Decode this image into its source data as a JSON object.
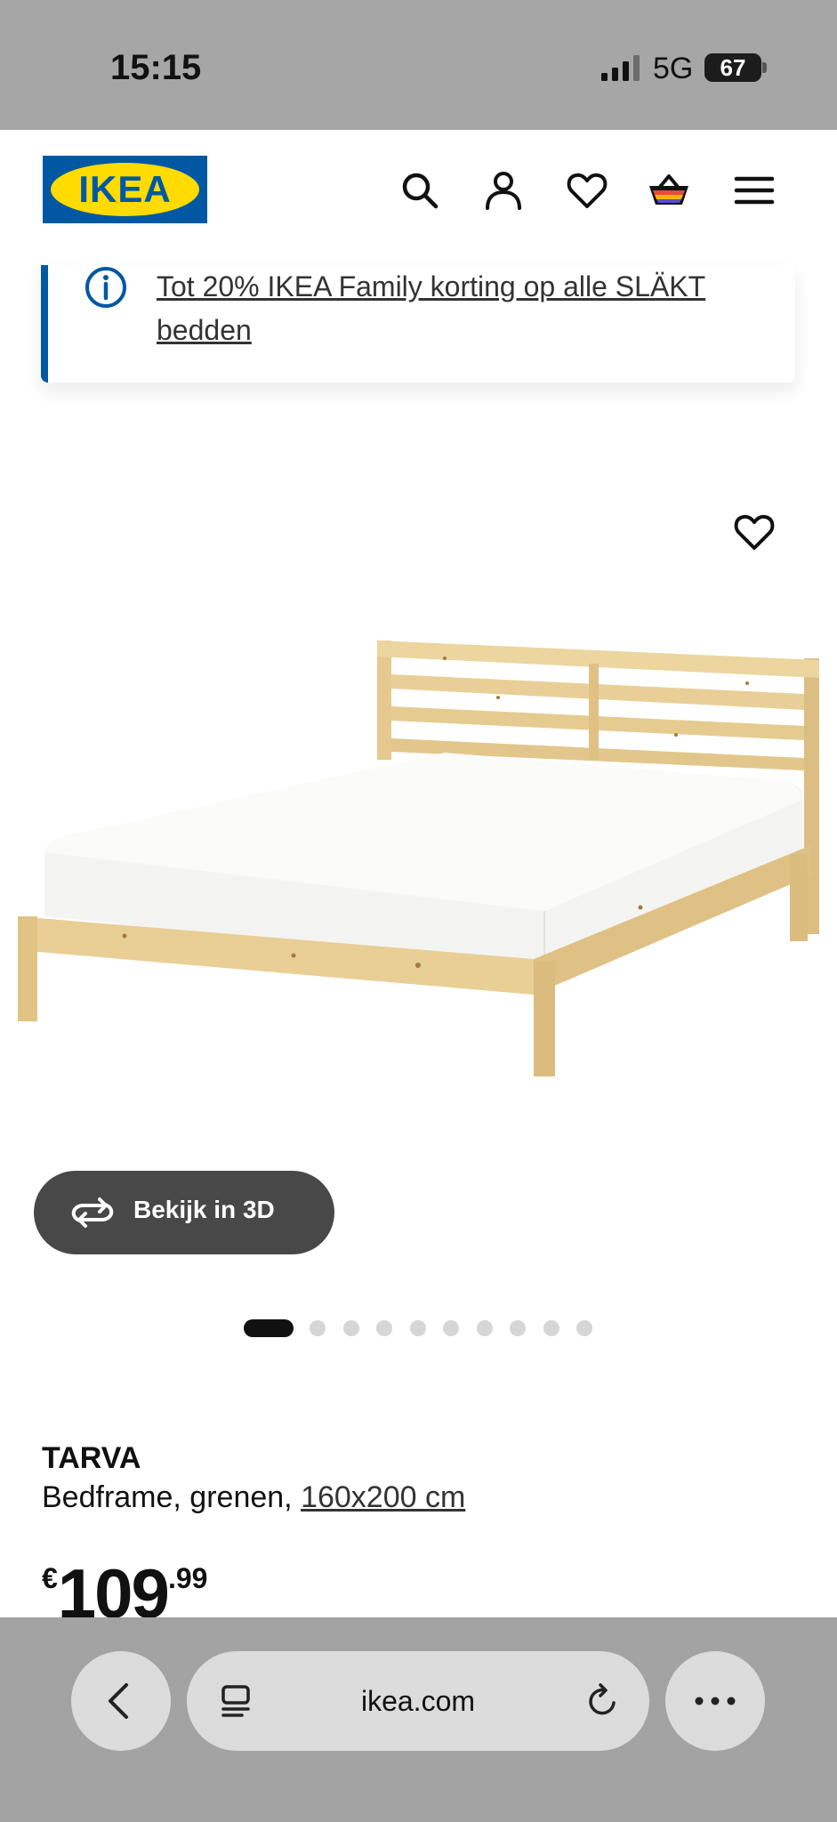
{
  "status_bar": {
    "time": "15:15",
    "network": "5G",
    "battery": "67",
    "battery_level": 0.67
  },
  "header": {
    "logo_text": "IKEA",
    "icons": [
      "search-icon",
      "user-icon",
      "heart-icon",
      "cart-icon",
      "menu-icon"
    ]
  },
  "banner": {
    "text": "Tot 20% IKEA Family korting op alle SLÄKT bedden"
  },
  "gallery": {
    "view_3d_label": "Bekijk in 3D",
    "dot_count": 10,
    "active_index": 0
  },
  "product": {
    "name": "TARVA",
    "description": "Bedframe, grenen, ",
    "size": "160x200 cm",
    "price_currency": "€",
    "price_main": "109",
    "price_decimal": ".99"
  },
  "browser": {
    "url": "ikea.com"
  },
  "colors": {
    "ikea_blue": "#0058a3",
    "ikea_yellow": "#ffdb00",
    "button_dark": "#484848"
  }
}
